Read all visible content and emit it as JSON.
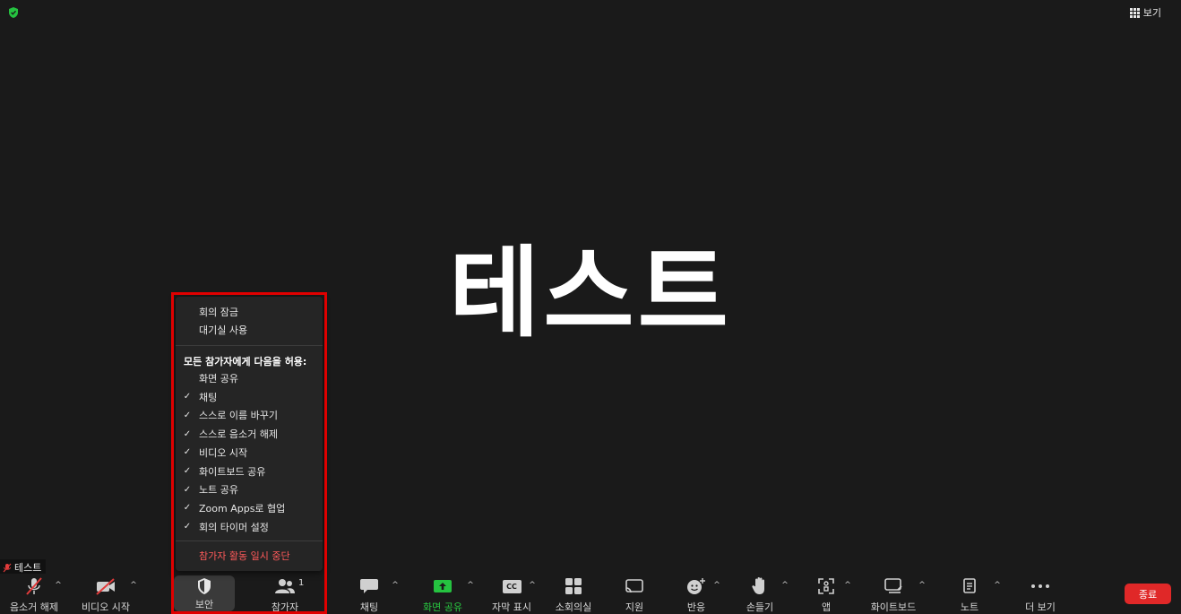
{
  "header": {
    "view_label": "보기",
    "shield_color": "#25c240"
  },
  "main": {
    "participant_display_name": "테스트",
    "name_tag": "테스트"
  },
  "security_menu": {
    "lock_meeting": "회의 잠금",
    "enable_waiting_room": "대기실 사용",
    "allow_heading": "모든 참가자에게 다음을 허용:",
    "permissions": [
      {
        "label": "화면 공유",
        "checked": false
      },
      {
        "label": "채팅",
        "checked": true
      },
      {
        "label": "스스로 이름 바꾸기",
        "checked": true
      },
      {
        "label": "스스로 음소거 해제",
        "checked": true
      },
      {
        "label": "비디오 시작",
        "checked": true
      },
      {
        "label": "화이트보드 공유",
        "checked": true
      },
      {
        "label": "노트 공유",
        "checked": true
      },
      {
        "label": "Zoom Apps로 협업",
        "checked": true
      },
      {
        "label": "회의 타이머 설정",
        "checked": true
      }
    ],
    "checkmark": "✓",
    "suspend_activities": "참가자 활동 일시 중단"
  },
  "toolbar": {
    "unmute": "음소거 해제",
    "start_video": "비디오 시작",
    "security": "보안",
    "participants": "참가자",
    "participants_count": "1",
    "chat": "채팅",
    "share_screen": "화면 공유",
    "captions": "자막 표시",
    "captions_icon_text": "CC",
    "breakout_rooms": "소회의실",
    "support": "지원",
    "reactions": "반응",
    "raise_hand": "손들기",
    "apps": "앱",
    "whiteboard": "화이트보드",
    "notes": "노트",
    "more": "더 보기",
    "end": "종료",
    "caret": "^",
    "accent_green": "#25c240",
    "end_red": "#e02828"
  }
}
